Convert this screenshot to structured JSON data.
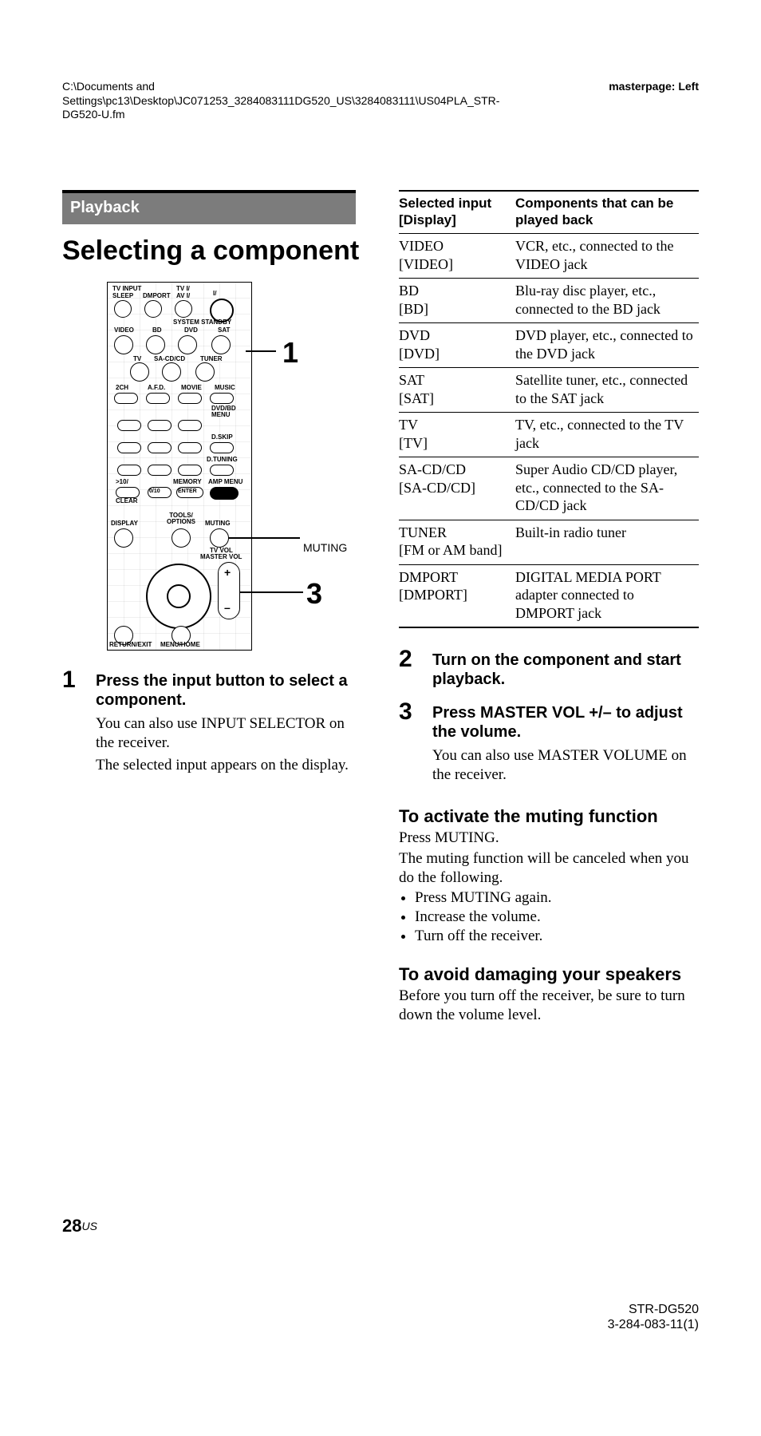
{
  "header": {
    "path": "C:\\Documents and Settings\\pc13\\Desktop\\JC071253_3284083111DG520_US\\3284083111\\US04PLA_STR-DG520-U.fm",
    "masterpage": "masterpage: Left"
  },
  "section_band": "Playback",
  "title": "Selecting a component",
  "remote": {
    "top_labels": {
      "tv_input": "TV INPUT",
      "sleep": "SLEEP",
      "dmport": "DMPORT",
      "tv_power": "TV I/",
      "av_power": "AV I/",
      "power": "I/",
      "system_standby": "SYSTEM STANDBY"
    },
    "input_row1": {
      "video": "VIDEO",
      "bd": "BD",
      "dvd": "DVD",
      "sat": "SAT"
    },
    "input_row2": {
      "tv": "TV",
      "sacd": "SA-CD/CD",
      "tuner": "TUNER"
    },
    "sound_row": {
      "twoch": "2CH",
      "afd": "A.F.D.",
      "movie": "MOVIE",
      "music": "MUSIC"
    },
    "menu": "DVD/BD MENU",
    "dskip": "D.SKIP",
    "dtuning": "D.TUNING",
    "number_labels": {
      "prev": ">10/",
      "zero": "0/10",
      "memory": "MEMORY",
      "enter": "ENTER",
      "clear": "CLEAR",
      "ampmenu": "AMP MENU"
    },
    "lower": {
      "display": "DISPLAY",
      "tools": "TOOLS/\nOPTIONS",
      "muting": "MUTING",
      "tvvol": "TV VOL",
      "mastervol": "MASTER VOL",
      "return": "RETURN/EXIT",
      "menuhome": "MENU/HOME"
    }
  },
  "callouts": {
    "one": "1",
    "three": "3",
    "muting": "MUTING"
  },
  "step1": {
    "num": "1",
    "heading": "Press the input button to select a component.",
    "p1": "You can also use INPUT SELECTOR on the receiver.",
    "p2": "The selected input appears on the display."
  },
  "table": {
    "h1": "Selected input [Display]",
    "h2": "Components that can be played back",
    "rows": [
      {
        "left": "VIDEO\n[VIDEO]",
        "right": "VCR, etc., connected to the VIDEO jack"
      },
      {
        "left": "BD\n[BD]",
        "right": "Blu-ray disc player, etc., connected to the BD jack"
      },
      {
        "left": "DVD\n[DVD]",
        "right": "DVD player, etc., connected to the DVD jack"
      },
      {
        "left": "SAT\n[SAT]",
        "right": "Satellite tuner, etc., connected to the SAT jack"
      },
      {
        "left": "TV\n[TV]",
        "right": "TV, etc., connected to the TV jack"
      },
      {
        "left": "SA-CD/CD\n[SA-CD/CD]",
        "right": "Super Audio CD/CD player, etc., connected to the SA-CD/CD jack"
      },
      {
        "left": "TUNER\n[FM or AM band]",
        "right": "Built-in radio tuner"
      },
      {
        "left": "DMPORT\n[DMPORT]",
        "right": "DIGITAL MEDIA PORT adapter connected to DMPORT jack"
      }
    ]
  },
  "step2": {
    "num": "2",
    "heading": "Turn on the component and start playback."
  },
  "step3": {
    "num": "3",
    "heading": "Press MASTER VOL +/– to adjust the volume.",
    "p1": "You can also use MASTER VOLUME on the receiver."
  },
  "muting": {
    "heading": "To activate the muting function",
    "p1": "Press MUTING.",
    "p2": "The muting function will be canceled when you do the following.",
    "bullets": [
      "Press MUTING again.",
      "Increase the volume.",
      "Turn off the receiver."
    ]
  },
  "speakers": {
    "heading": "To avoid damaging your speakers",
    "p1": "Before you turn off the receiver, be sure to turn down the volume level."
  },
  "page_number": {
    "num": "28",
    "suffix": "US"
  },
  "footer": {
    "model": "STR-DG520",
    "docnum": "3-284-083-11(1)"
  }
}
